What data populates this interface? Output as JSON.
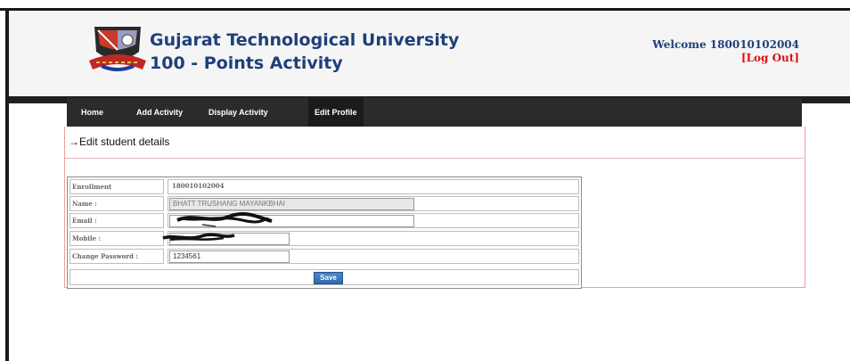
{
  "header": {
    "university_name": "Gujarat Technological University",
    "subtitle": "100 - Points Activity",
    "welcome_text": "Welcome 180010102004",
    "logout_label": "[Log Out]"
  },
  "nav": {
    "items": [
      {
        "label": "Home"
      },
      {
        "label": "Add Activity"
      },
      {
        "label": "Display Activity"
      },
      {
        "label": "Edit Profile"
      }
    ]
  },
  "section": {
    "title": "→Edit student details"
  },
  "form": {
    "enrollment_label": "Enrollment",
    "enrollment_value": "180010102004",
    "name_label": "Name :",
    "name_value": "BHATT TRUSHANG MAYANKBHAI",
    "email_label": "Email :",
    "mobile_label": "Mobile :",
    "password_label": "Change Password :",
    "password_value": "1234561",
    "save_label": "Save"
  },
  "colors": {
    "title": "#1f3f7a",
    "logout": "#e01010",
    "navbar": "#2b2b2b",
    "save_button": "#2e6db4"
  }
}
